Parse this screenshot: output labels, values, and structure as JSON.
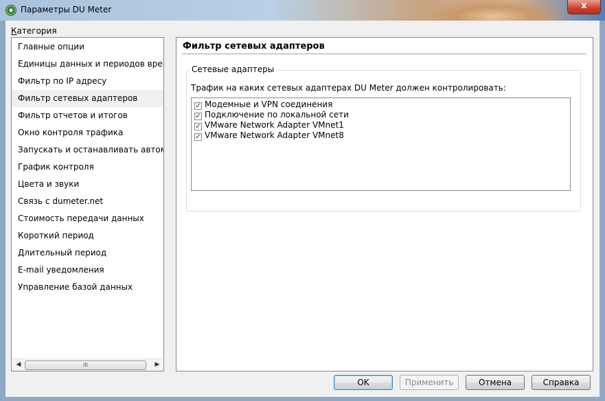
{
  "window": {
    "title": "Параметры DU Meter",
    "close_glyph": "x"
  },
  "sidebar": {
    "label_u": "К",
    "label_rest": "атегория",
    "items": [
      {
        "label": "Главные опции"
      },
      {
        "label": "Единицы данных и периодов времени"
      },
      {
        "label": "Фильтр по IP адресу"
      },
      {
        "label": "Фильтр сетевых адаптеров"
      },
      {
        "label": "Фильтр отчетов и итогов"
      },
      {
        "label": "Окно контроля трафика"
      },
      {
        "label": "Запускать и останавливать автоматически"
      },
      {
        "label": "График контроля"
      },
      {
        "label": "Цвета и звуки"
      },
      {
        "label": "Связь с dumeter.net"
      },
      {
        "label": "Стоимость передачи данных"
      },
      {
        "label": "Короткий период"
      },
      {
        "label": "Длительный период"
      },
      {
        "label": "E-mail уведомления"
      },
      {
        "label": "Управление базой данных"
      }
    ],
    "selected_index": 3,
    "scroll_thumb_grip": "III"
  },
  "panel": {
    "title": "Фильтр сетевых адаптеров",
    "group_label": "Сетевые адаптеры",
    "description": "Трафик на каких сетевых адаптерах DU Meter должен контролировать:",
    "adapters": [
      {
        "label": "Модемные и VPN соединения",
        "checked": true
      },
      {
        "label": "Подключение по локальной сети",
        "checked": true
      },
      {
        "label": "VMware Network Adapter VMnet1",
        "checked": true
      },
      {
        "label": "VMware Network Adapter VMnet8",
        "checked": true
      }
    ]
  },
  "buttons": {
    "ok": "OK",
    "apply": "Применить",
    "cancel": "Отмена",
    "help": "Справка"
  },
  "colors": {
    "selected_bg": "#f0f0f0",
    "default_button_border": "#3c7fb1"
  }
}
